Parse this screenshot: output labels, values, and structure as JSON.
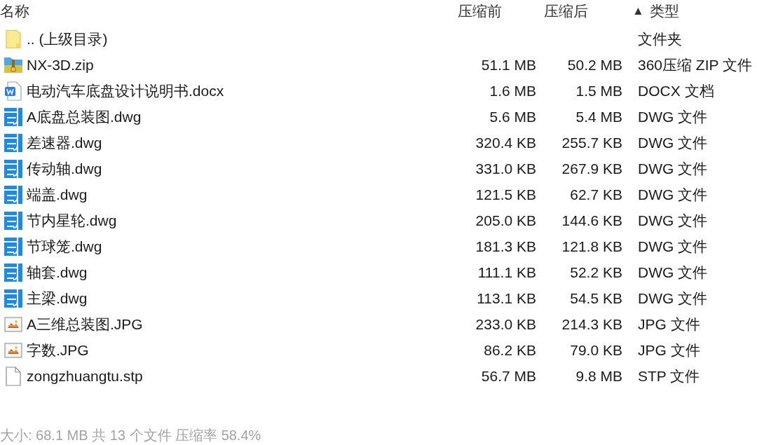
{
  "columns": [
    {
      "label": "名称"
    },
    {
      "label": "压缩前"
    },
    {
      "label": "压缩后"
    },
    {
      "label": "类型",
      "sort_indicator": "▲"
    }
  ],
  "rows": [
    {
      "kind": "folder",
      "name": ".. (上级目录)",
      "type": "文件夹"
    },
    {
      "kind": "zip",
      "name": "NX-3D.zip",
      "size_before": "51.1 MB",
      "size_after": "50.2 MB",
      "type": "360压缩 ZIP 文件"
    },
    {
      "kind": "word",
      "name": "电动汽车底盘设计说明书.docx",
      "size_before": "1.6 MB",
      "size_after": "1.5 MB",
      "type": "DOCX 文档"
    },
    {
      "kind": "cad",
      "name": "A底盘总装图.dwg",
      "size_before": "5.6 MB",
      "size_after": "5.4 MB",
      "type": "DWG 文件"
    },
    {
      "kind": "cad",
      "name": "差速器.dwg",
      "size_before": "320.4 KB",
      "size_after": "255.7 KB",
      "type": "DWG 文件"
    },
    {
      "kind": "cad",
      "name": "传动轴.dwg",
      "size_before": "331.0 KB",
      "size_after": "267.9 KB",
      "type": "DWG 文件"
    },
    {
      "kind": "cad",
      "name": "端盖.dwg",
      "size_before": "121.5 KB",
      "size_after": "62.7 KB",
      "type": "DWG 文件"
    },
    {
      "kind": "cad",
      "name": "节内星轮.dwg",
      "size_before": "205.0 KB",
      "size_after": "144.6 KB",
      "type": "DWG 文件"
    },
    {
      "kind": "cad",
      "name": "节球笼.dwg",
      "size_before": "181.3 KB",
      "size_after": "121.8 KB",
      "type": "DWG 文件"
    },
    {
      "kind": "cad",
      "name": "轴套.dwg",
      "size_before": "111.1 KB",
      "size_after": "52.2 KB",
      "type": "DWG 文件"
    },
    {
      "kind": "cad",
      "name": "主梁.dwg",
      "size_before": "113.1 KB",
      "size_after": "54.5 KB",
      "type": "DWG 文件"
    },
    {
      "kind": "image",
      "name": "A三维总装图.JPG",
      "size_before": "233.0 KB",
      "size_after": "214.3 KB",
      "type": "JPG 文件"
    },
    {
      "kind": "image",
      "name": "字数.JPG",
      "size_before": "86.2 KB",
      "size_after": "79.0 KB",
      "type": "JPG 文件"
    },
    {
      "kind": "file",
      "name": "zongzhuangtu.stp",
      "size_before": "56.7 MB",
      "size_after": "9.8 MB",
      "type": "STP 文件"
    }
  ],
  "status_bar": "大小: 68.1 MB 共 13 个文件 压缩率 58.4%"
}
